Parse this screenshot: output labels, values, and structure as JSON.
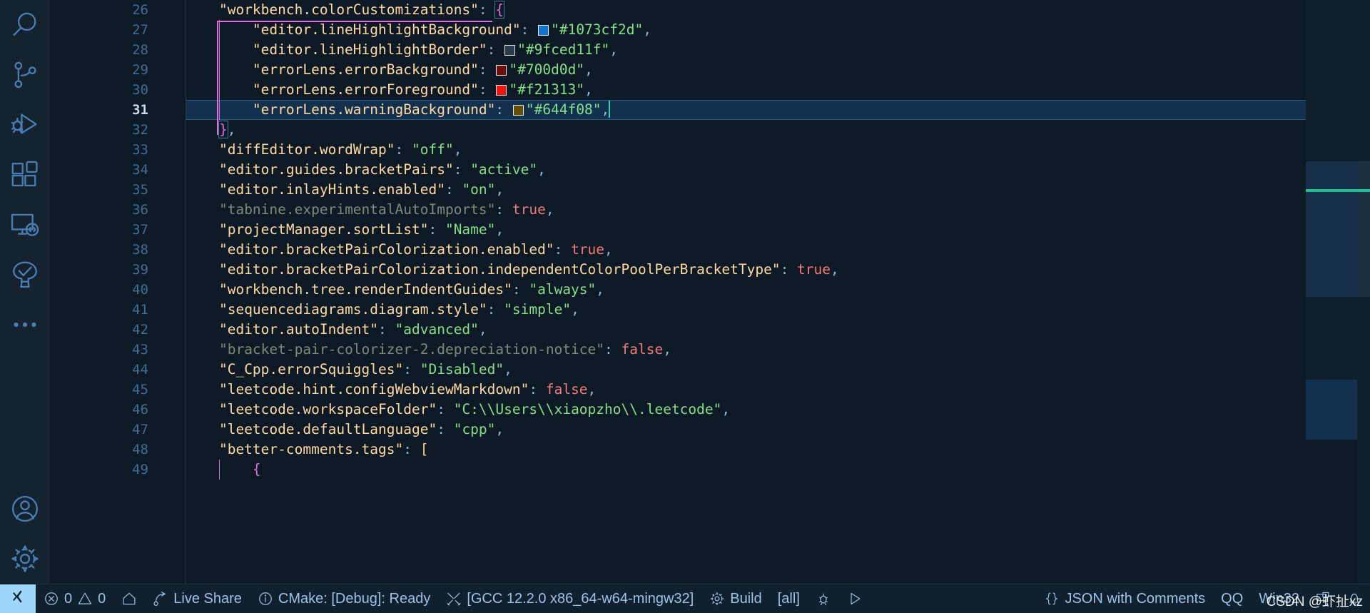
{
  "app": {
    "theme_bg": "#0d1a26",
    "accent": "#9ed6f7"
  },
  "activity_bar": {
    "items": [
      {
        "name": "search",
        "icon": "search-icon",
        "title": "Search"
      },
      {
        "name": "source-control",
        "icon": "source-control-icon",
        "title": "Source Control"
      },
      {
        "name": "run-and-debug",
        "icon": "run-and-debug-icon",
        "title": "Run and Debug"
      },
      {
        "name": "extensions",
        "icon": "extensions-icon",
        "title": "Extensions"
      },
      {
        "name": "remote-explorer",
        "icon": "remote-explorer-icon",
        "title": "Remote Explorer"
      },
      {
        "name": "testing",
        "icon": "testing-beaker-icon",
        "title": "Testing"
      },
      {
        "name": "more-views",
        "icon": "ellipsis-icon",
        "title": "Additional Views"
      }
    ],
    "bottom_items": [
      {
        "name": "accounts",
        "icon": "account-icon",
        "title": "Accounts"
      },
      {
        "name": "manage",
        "icon": "gear-icon",
        "title": "Manage"
      }
    ]
  },
  "editor": {
    "language": "JSON with Comments",
    "cursor_line": 31,
    "first_visible_line": 26,
    "lines": [
      {
        "n": 26,
        "indent": 1,
        "tokens": [
          {
            "t": "key",
            "v": "\"workbench.colorCustomizations\""
          },
          {
            "t": "punc",
            "v": ": "
          },
          {
            "t": "br1box",
            "v": "{"
          }
        ]
      },
      {
        "n": 27,
        "indent": 2,
        "tokens": [
          {
            "t": "key",
            "v": "\"editor.lineHighlightBackground\""
          },
          {
            "t": "punc",
            "v": ": "
          },
          {
            "t": "swatch",
            "v": "#1073cf"
          },
          {
            "t": "str",
            "v": "\"#1073cf2d\""
          },
          {
            "t": "punc",
            "v": ","
          }
        ]
      },
      {
        "n": 28,
        "indent": 2,
        "tokens": [
          {
            "t": "key",
            "v": "\"editor.lineHighlightBorder\""
          },
          {
            "t": "punc",
            "v": ": "
          },
          {
            "t": "swatch",
            "v": "#2b3c4a"
          },
          {
            "t": "str",
            "v": "\"#9fced11f\""
          },
          {
            "t": "punc",
            "v": ","
          }
        ]
      },
      {
        "n": 29,
        "indent": 2,
        "tokens": [
          {
            "t": "key",
            "v": "\"errorLens.errorBackground\""
          },
          {
            "t": "punc",
            "v": ": "
          },
          {
            "t": "swatch",
            "v": "#700d0d"
          },
          {
            "t": "str",
            "v": "\"#700d0d\""
          },
          {
            "t": "punc",
            "v": ","
          }
        ]
      },
      {
        "n": 30,
        "indent": 2,
        "tokens": [
          {
            "t": "key",
            "v": "\"errorLens.errorForeground\""
          },
          {
            "t": "punc",
            "v": ": "
          },
          {
            "t": "swatch",
            "v": "#f21313"
          },
          {
            "t": "str",
            "v": "\"#f21313\""
          },
          {
            "t": "punc",
            "v": ","
          }
        ]
      },
      {
        "n": 31,
        "indent": 2,
        "current": true,
        "tokens": [
          {
            "t": "key",
            "v": "\"errorLens.warningBackground\""
          },
          {
            "t": "punc",
            "v": ": "
          },
          {
            "t": "swatch",
            "v": "#644f08"
          },
          {
            "t": "str",
            "v": "\"#644f08\""
          },
          {
            "t": "punc",
            "v": ","
          },
          {
            "t": "caret",
            "v": ""
          }
        ]
      },
      {
        "n": 32,
        "indent": 1,
        "tokens": [
          {
            "t": "br1box",
            "v": "}"
          },
          {
            "t": "punc",
            "v": ","
          }
        ]
      },
      {
        "n": 33,
        "indent": 1,
        "tokens": [
          {
            "t": "key",
            "v": "\"diffEditor.wordWrap\""
          },
          {
            "t": "punc",
            "v": ": "
          },
          {
            "t": "str",
            "v": "\"off\""
          },
          {
            "t": "punc",
            "v": ","
          }
        ]
      },
      {
        "n": 34,
        "indent": 1,
        "tokens": [
          {
            "t": "key",
            "v": "\"editor.guides.bracketPairs\""
          },
          {
            "t": "punc",
            "v": ": "
          },
          {
            "t": "str",
            "v": "\"active\""
          },
          {
            "t": "punc",
            "v": ","
          }
        ]
      },
      {
        "n": 35,
        "indent": 1,
        "tokens": [
          {
            "t": "key",
            "v": "\"editor.inlayHints.enabled\""
          },
          {
            "t": "punc",
            "v": ": "
          },
          {
            "t": "str",
            "v": "\"on\""
          },
          {
            "t": "punc",
            "v": ","
          }
        ]
      },
      {
        "n": 36,
        "indent": 1,
        "tokens": [
          {
            "t": "dimkey",
            "v": "\"tabnine.experimentalAutoImports\""
          },
          {
            "t": "punc",
            "v": ": "
          },
          {
            "t": "bool",
            "v": "true"
          },
          {
            "t": "punc",
            "v": ","
          }
        ]
      },
      {
        "n": 37,
        "indent": 1,
        "tokens": [
          {
            "t": "key",
            "v": "\"projectManager.sortList\""
          },
          {
            "t": "punc",
            "v": ": "
          },
          {
            "t": "str",
            "v": "\"Name\""
          },
          {
            "t": "punc",
            "v": ","
          }
        ]
      },
      {
        "n": 38,
        "indent": 1,
        "tokens": [
          {
            "t": "key",
            "v": "\"editor.bracketPairColorization.enabled\""
          },
          {
            "t": "punc",
            "v": ": "
          },
          {
            "t": "bool",
            "v": "true"
          },
          {
            "t": "punc",
            "v": ","
          }
        ]
      },
      {
        "n": 39,
        "indent": 1,
        "tokens": [
          {
            "t": "key",
            "v": "\"editor.bracketPairColorization.independentColorPoolPerBracketType\""
          },
          {
            "t": "punc",
            "v": ": "
          },
          {
            "t": "bool",
            "v": "true"
          },
          {
            "t": "punc",
            "v": ","
          }
        ]
      },
      {
        "n": 40,
        "indent": 1,
        "tokens": [
          {
            "t": "key",
            "v": "\"workbench.tree.renderIndentGuides\""
          },
          {
            "t": "punc",
            "v": ": "
          },
          {
            "t": "str",
            "v": "\"always\""
          },
          {
            "t": "punc",
            "v": ","
          }
        ]
      },
      {
        "n": 41,
        "indent": 1,
        "tokens": [
          {
            "t": "key",
            "v": "\"sequencediagrams.diagram.style\""
          },
          {
            "t": "punc",
            "v": ": "
          },
          {
            "t": "str",
            "v": "\"simple\""
          },
          {
            "t": "punc",
            "v": ","
          }
        ]
      },
      {
        "n": 42,
        "indent": 1,
        "tokens": [
          {
            "t": "key",
            "v": "\"editor.autoIndent\""
          },
          {
            "t": "punc",
            "v": ": "
          },
          {
            "t": "str",
            "v": "\"advanced\""
          },
          {
            "t": "punc",
            "v": ","
          }
        ]
      },
      {
        "n": 43,
        "indent": 1,
        "tokens": [
          {
            "t": "dimkey",
            "v": "\"bracket-pair-colorizer-2.depreciation-notice\""
          },
          {
            "t": "punc",
            "v": ": "
          },
          {
            "t": "bool",
            "v": "false"
          },
          {
            "t": "punc",
            "v": ","
          }
        ]
      },
      {
        "n": 44,
        "indent": 1,
        "tokens": [
          {
            "t": "key",
            "v": "\"C_Cpp.errorSquiggles\""
          },
          {
            "t": "punc",
            "v": ": "
          },
          {
            "t": "str",
            "v": "\"Disabled\""
          },
          {
            "t": "punc",
            "v": ","
          }
        ]
      },
      {
        "n": 45,
        "indent": 1,
        "tokens": [
          {
            "t": "key",
            "v": "\"leetcode.hint.configWebviewMarkdown\""
          },
          {
            "t": "punc",
            "v": ": "
          },
          {
            "t": "bool",
            "v": "false"
          },
          {
            "t": "punc",
            "v": ","
          }
        ]
      },
      {
        "n": 46,
        "indent": 1,
        "tokens": [
          {
            "t": "key",
            "v": "\"leetcode.workspaceFolder\""
          },
          {
            "t": "punc",
            "v": ": "
          },
          {
            "t": "str",
            "v": "\"C:\\\\Users\\\\xiaopzho\\\\.leetcode\""
          },
          {
            "t": "punc",
            "v": ","
          }
        ]
      },
      {
        "n": 47,
        "indent": 1,
        "tokens": [
          {
            "t": "key",
            "v": "\"leetcode.defaultLanguage\""
          },
          {
            "t": "punc",
            "v": ": "
          },
          {
            "t": "str",
            "v": "\"cpp\""
          },
          {
            "t": "punc",
            "v": ","
          }
        ]
      },
      {
        "n": 48,
        "indent": 1,
        "tokens": [
          {
            "t": "key",
            "v": "\"better-comments.tags\""
          },
          {
            "t": "punc",
            "v": ": "
          },
          {
            "t": "br2",
            "v": "["
          }
        ]
      },
      {
        "n": 49,
        "indent": 2,
        "tokens": [
          {
            "t": "br1",
            "v": "{"
          }
        ]
      }
    ]
  },
  "status_bar": {
    "remote_icon": "remote-window-icon",
    "left_items": [
      {
        "name": "problems",
        "icon": "error-warning-icon",
        "label": "0 ⚠ 0",
        "error_count": "0",
        "warning_count": "0"
      },
      {
        "name": "home",
        "icon": "home-icon",
        "label": ""
      },
      {
        "name": "live-share",
        "icon": "live-share-icon",
        "label": "Live Share"
      },
      {
        "name": "cmake-status",
        "icon": "info-icon",
        "label": "CMake: [Debug]: Ready"
      },
      {
        "name": "cmake-kit",
        "icon": "tools-icon",
        "label": "[GCC 12.2.0 x86_64-w64-mingw32]"
      },
      {
        "name": "cmake-build",
        "icon": "gear-icon",
        "label": "Build"
      },
      {
        "name": "cmake-target",
        "icon": "",
        "label": "[all]"
      },
      {
        "name": "cmake-debug",
        "icon": "bug-icon",
        "label": ""
      },
      {
        "name": "cmake-launch",
        "icon": "play-icon",
        "label": ""
      }
    ],
    "right_items": [
      {
        "name": "language-mode",
        "icon": "braces-icon",
        "label": "JSON with Comments"
      },
      {
        "name": "qq-extension",
        "icon": "",
        "label": "QQ"
      },
      {
        "name": "platform",
        "icon": "",
        "label": "Win32"
      },
      {
        "name": "screencast",
        "icon": "screen-icon",
        "label": ""
      },
      {
        "name": "notifications",
        "icon": "bell-icon",
        "label": ""
      }
    ],
    "watermark": "CSDN @虾扯xz"
  }
}
